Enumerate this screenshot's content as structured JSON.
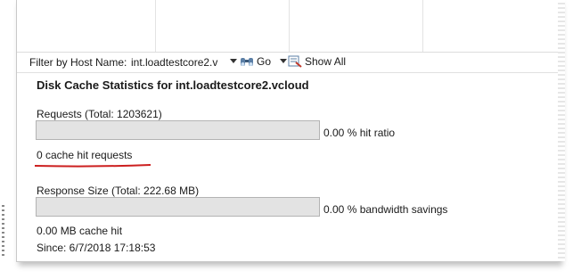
{
  "filter": {
    "label": "Filter by Host Name:",
    "host_value": "int.loadtestcore2.v",
    "go_label": "Go",
    "show_all_label": "Show All"
  },
  "section": {
    "title": "Disk Cache Statistics for int.loadtestcore2.vcloud"
  },
  "requests": {
    "label": "Requests (Total: 1203621)",
    "ratio_text": "0.00 % hit ratio",
    "hit_ratio_percent": 0,
    "hits_text": "0 cache hit requests"
  },
  "response": {
    "label": "Response Size (Total: 222.68 MB)",
    "savings_text": "0.00 % bandwidth savings",
    "savings_percent": 0,
    "hit_text": "0.00 MB cache hit"
  },
  "since": "Since: 6/7/2018 17:18:53",
  "colors": {
    "annotation_underline": "#cc1f1f",
    "bar_bg": "#e3e3e3"
  }
}
